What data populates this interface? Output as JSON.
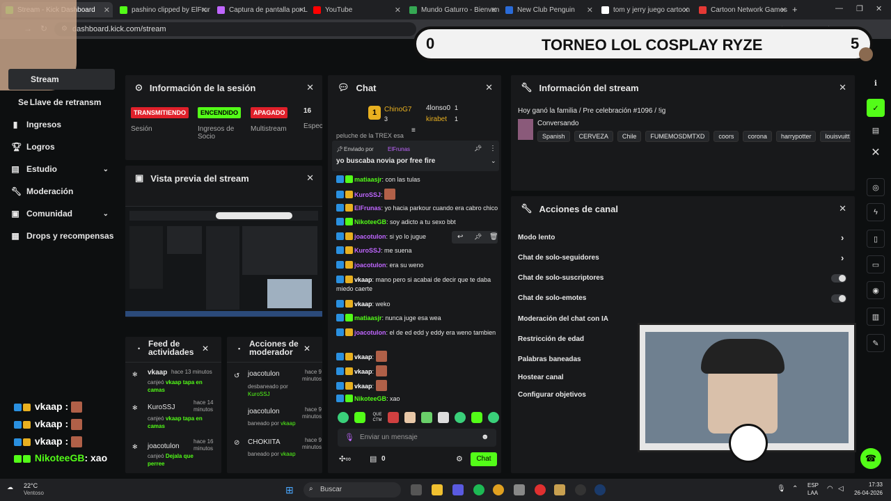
{
  "browser": {
    "tabs": [
      {
        "label": "Stream - Kick Dashboard",
        "color": "#53fc18"
      },
      {
        "label": "pashino clipped by ElFrun",
        "color": "#53fc18"
      },
      {
        "label": "Captura de pantalla por L",
        "color": "#c066ff"
      },
      {
        "label": "YouTube",
        "color": "#ff0000"
      },
      {
        "label": "Mundo Gaturro - Bienven",
        "color": "#35a853"
      },
      {
        "label": "New Club Penguin",
        "color": "#2a6bd8"
      },
      {
        "label": "tom y jerry juego cartoon",
        "color": "#ffffff"
      },
      {
        "label": "Cartoon Network Games",
        "color": "#e53935"
      }
    ],
    "url": "dashboard.kick.com/stream"
  },
  "overlay": {
    "title": "TORNEO LOL COSPLAY RYZE",
    "score_left": "0",
    "score_right": "5"
  },
  "sidebar": {
    "items": [
      {
        "label": "Stream",
        "icon": "stream-icon"
      },
      {
        "label": "Llave de retransm",
        "prefix": "Se"
      },
      {
        "label": "Ingresos",
        "icon": "bar-chart-icon"
      },
      {
        "label": "Logros",
        "icon": "trophy-icon"
      },
      {
        "label": "Estudio",
        "icon": "studio-icon"
      },
      {
        "label": "Moderación",
        "icon": "wrench-icon"
      },
      {
        "label": "Comunidad",
        "icon": "community-icon"
      },
      {
        "label": "Drops y recompensas",
        "icon": "drops-icon"
      }
    ]
  },
  "session": {
    "title": "Información de la sesión",
    "badges": [
      {
        "text": "TRANSMITIENDO",
        "label": "Sesión",
        "bg": "#e0202a",
        "fg": "#ffffff"
      },
      {
        "text": "ENCENDIDO",
        "label": "Ingresos de Socio",
        "bg": "#53fc18",
        "fg": "#000000"
      },
      {
        "text": "APAGADO",
        "label": "Multistream",
        "bg": "#e0202a",
        "fg": "#ffffff"
      }
    ],
    "count": "16",
    "count_label": "Espec"
  },
  "preview": {
    "title": "Vista previa del stream"
  },
  "feed": {
    "title": "Feed de actividades",
    "items": [
      {
        "user": "vkaap",
        "time": "hace 13 minutos",
        "text": "canjeó",
        "highlight": "vkaap tapa en camas"
      },
      {
        "user": "KuroSSJ",
        "time": "hace 14 minutos",
        "text": "canjeó",
        "highlight": "vkaap tapa en camas"
      },
      {
        "user": "joacotulon",
        "time": "hace 16 minutos",
        "text": "canjeó",
        "highlight": "Dejala que perree"
      }
    ]
  },
  "modactions": {
    "title": "Acciones de moderador",
    "items": [
      {
        "user": "joacotulon",
        "time": "hace 9 minutos",
        "action": "desbaneado por",
        "by": "KuroSSJ"
      },
      {
        "user": "joacotulon",
        "time": "hace 9 minutos",
        "action": "baneado por",
        "by": "vkaap"
      },
      {
        "user": "CHOKIITA",
        "time": "hace 9 minutos",
        "action": "baneado por",
        "by": "vkaap"
      }
    ]
  },
  "chat": {
    "title": "Chat",
    "leaders": [
      {
        "rank": "1",
        "user": "ChinoG7",
        "count": "3"
      },
      {
        "user": "4lonso0",
        "count": "1"
      },
      {
        "user": "kirabet",
        "count": "1"
      }
    ],
    "cut_text": "peluche de la TREX esa",
    "pinned": {
      "label": "Enviado por",
      "user": "ElFrunas",
      "text": "yo buscaba novia por free fire"
    },
    "messages": [
      {
        "user": "matiaasjr",
        "color": "#53fc18",
        "text": "con las tulas"
      },
      {
        "user": "KuroSSJ",
        "color": "#c066ff",
        "text": "",
        "emote": true
      },
      {
        "user": "ElFrunas",
        "color": "#c066ff",
        "text": "yo hacia parkour cuando era cabro chico"
      },
      {
        "user": "NikoteeGB",
        "color": "#53fc18",
        "text": "soy adicto a tu sexo bbt"
      },
      {
        "user": "joacotulon",
        "color": "#c066ff",
        "text": "si yo lo jugue"
      },
      {
        "user": "KuroSSJ",
        "color": "#c066ff",
        "text": "me suena"
      },
      {
        "user": "joacotulon",
        "color": "#c066ff",
        "text": "era su weno"
      },
      {
        "user": "vkaap",
        "color": "#ffffff",
        "text": "mano pero si acabai de decir que te daba miedo caerte"
      },
      {
        "user": "vkaap",
        "color": "#ffffff",
        "text": "weko"
      },
      {
        "user": "matiaasjr",
        "color": "#53fc18",
        "text": "nunca juge esa wea"
      },
      {
        "user": "joacotulon",
        "color": "#c066ff",
        "text": "el de ed edd y eddy era weno tambien"
      },
      {
        "user": "vkaap",
        "color": "#ffffff",
        "text": "",
        "emote": true
      },
      {
        "user": "vkaap",
        "color": "#ffffff",
        "text": "",
        "emote": true
      },
      {
        "user": "vkaap",
        "color": "#ffffff",
        "text": "",
        "emote": true
      },
      {
        "user": "NikoteeGB",
        "color": "#53fc18",
        "text": "xao"
      }
    ],
    "input_placeholder": "Enviar un mensaje",
    "footer_count": "0",
    "send_label": "Chat"
  },
  "streaminfo": {
    "title": "Información del stream",
    "stream_title": "Hoy ganó la familia / Pre celebración #1096 / !ig",
    "category": "Conversando",
    "tags": [
      "Spanish",
      "CERVEZA",
      "Chile",
      "FUMEMOSDMTXD",
      "coors",
      "corona",
      "harrypotter",
      "louisvuitt"
    ]
  },
  "channel": {
    "title": "Acciones de canal",
    "rows": [
      "Modo lento",
      "Chat de solo-seguidores",
      "Chat de solo-suscriptores",
      "Chat de solo-emotes",
      "Moderación del chat con IA",
      "Restricción de edad",
      "Palabras baneadas",
      "Hostear canal",
      "Configurar objetivos"
    ]
  },
  "overlay_chat": [
    {
      "user": "vkaap :"
    },
    {
      "user": "vkaap :"
    },
    {
      "user": "vkaap :"
    },
    {
      "user": "NikoteeGB",
      "text": ": xao"
    }
  ],
  "taskbar": {
    "temp": "22°C",
    "weather": "Ventoso",
    "search": "Buscar",
    "lang1": "ESP",
    "lang2": "LAA",
    "time": "17:33",
    "date": "26-04-2026"
  },
  "colors": {
    "accent": "#53fc18",
    "panel": "#18191b",
    "bg": "#0d0f10"
  }
}
